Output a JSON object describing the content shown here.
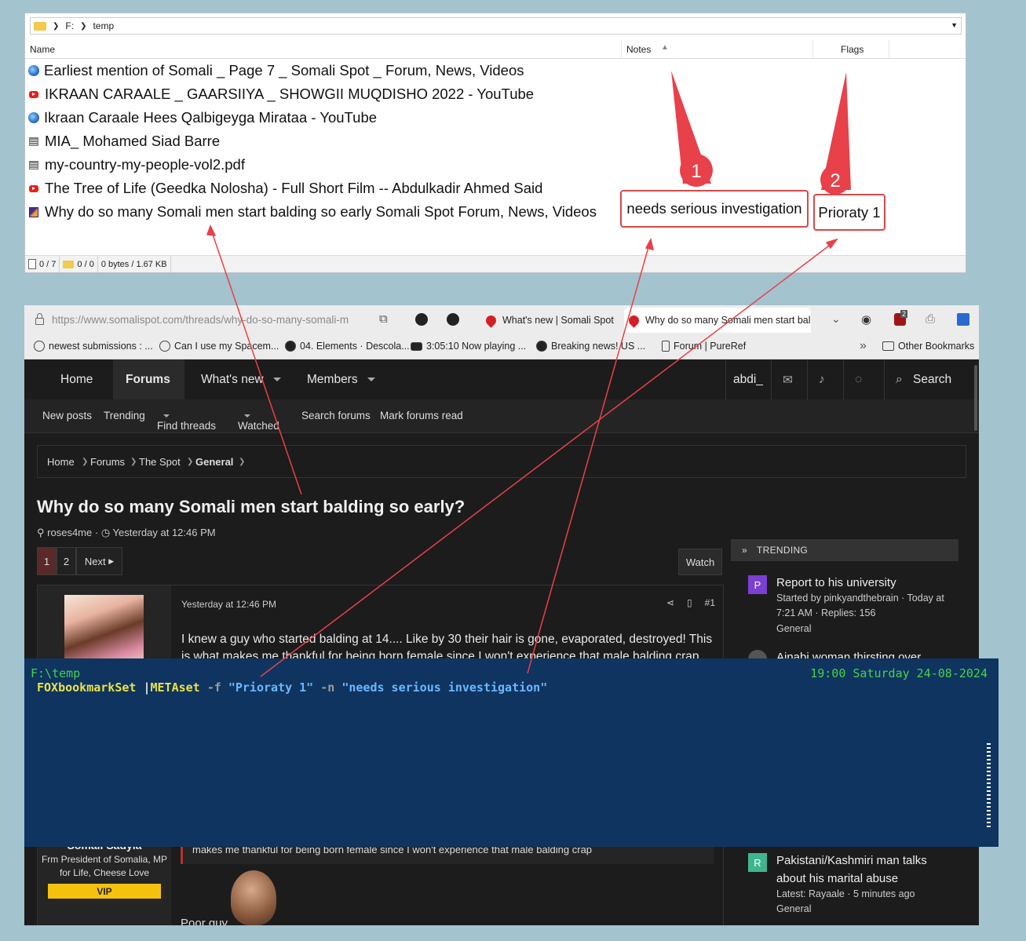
{
  "file_manager": {
    "breadcrumb": [
      "F:",
      "temp"
    ],
    "columns": {
      "name": "Name",
      "notes": "Notes",
      "flags": "Flags"
    },
    "rows": [
      {
        "icon": "globe-icon",
        "name": "Earliest mention of Somali _ Page 7 _ Somali Spot _ Forum, News, Videos"
      },
      {
        "icon": "youtube-icon",
        "name": "IKRAAN CARAALE _ GAARSIIYA _ SHOWGII MUQDISHO 2022 - YouTube"
      },
      {
        "icon": "globe-icon",
        "name": "Ikraan Caraale Hees Qalbigeyga Mirataa - YouTube"
      },
      {
        "icon": "image-icon",
        "name": "MIA_ Mohamed Siad Barre"
      },
      {
        "icon": "image-icon",
        "name": "my-country-my-people-vol2.pdf"
      },
      {
        "icon": "youtube-icon",
        "name": "The Tree of Life (Geedka Nolosha) - Full Short Film -- Abdulkadir Ahmed Said"
      },
      {
        "icon": "book-icon",
        "name": "Why do so many Somali men start balding so early  Somali Spot  Forum, News, Videos",
        "notes": "needs serious investigation",
        "flags": "Prioraty 1"
      }
    ],
    "status": {
      "files": "0 / 7",
      "folders": "0 / 0",
      "size": "0 bytes / 1.67 KB"
    }
  },
  "annotations": {
    "marker1": "1",
    "marker2": "2",
    "color": "#e8414a"
  },
  "browser": {
    "url": "https://www.somalispot.com/threads/why-do-so-many-somali-m",
    "tabs": [
      {
        "label": "What's new | Somali Spot |"
      },
      {
        "label": "Why do so many Somali men start bal"
      }
    ],
    "extension_badge": "2",
    "bookmarks": [
      "newest submissions : ...",
      "Can I use my Spacem...",
      "04. Elements · Descola...",
      "3:05:10  Now playing  ...",
      "Breaking news! US ...",
      "Forum | PureRef"
    ],
    "bookmarks_more": "Other Bookmarks",
    "nav": {
      "home": "Home",
      "forums": "Forums",
      "whats_new": "What's new",
      "members": "Members",
      "user": "abdi_",
      "search": "Search"
    },
    "subnav": [
      "New posts",
      "Trending",
      "Find threads",
      "Watched",
      "Search forums",
      "Mark forums read"
    ],
    "crumbs": [
      "Home",
      "Forums",
      "The Spot",
      "General"
    ],
    "thread": {
      "title": "Why do so many Somali men start balding so early?",
      "author": "roses4me",
      "time": "Yesterday at 12:46 PM",
      "pages": [
        "1",
        "2"
      ],
      "next": "Next",
      "watch": "Watch"
    },
    "post": {
      "date": "Yesterday at 12:46 PM",
      "number": "#1",
      "body": "I knew a guy who started balding at 14.... Like by 30 their hair is gone, evaporated, destroyed! This is what makes me thankful for being born female since I won't experience that male balding crap",
      "user_name": "Somali Sadyia",
      "user_title": "Frm President of Somalia, MP for Life, Cheese Love",
      "user_badge": "VIP",
      "quote": "makes me thankful for being born female since I won't experience that male balding crap",
      "reply": "Poor guy"
    },
    "trending": {
      "header": "TRENDING",
      "items": [
        {
          "badge": "P",
          "color": "#7b3fd1",
          "title": "Report to his university",
          "sub": "Started by pinkyandthebrain · Today at 7:21 AM · Replies: 156",
          "forum": "General"
        },
        {
          "badge": "",
          "color": "#555555",
          "title": "Ajnabi woman thirsting over",
          "sub": "",
          "forum": ""
        },
        {
          "badge": "R",
          "color": "#3fb58f",
          "title": "Pakistani/Kashmiri man talks about his marital abuse",
          "sub": "Latest: Rayaale · 5 minutes ago",
          "forum": "General"
        }
      ]
    }
  },
  "terminal": {
    "path": "F:\\temp",
    "clock": "19:00 Saturday 24-08-2024",
    "cmd": {
      "prog1": "FOXbookmarkSet",
      "pipe": "|",
      "prog2": "METAset",
      "flag_f": "-f",
      "val_f": "\"Prioraty 1\"",
      "flag_n": "-n",
      "val_n": "\"needs serious investigation\""
    }
  }
}
